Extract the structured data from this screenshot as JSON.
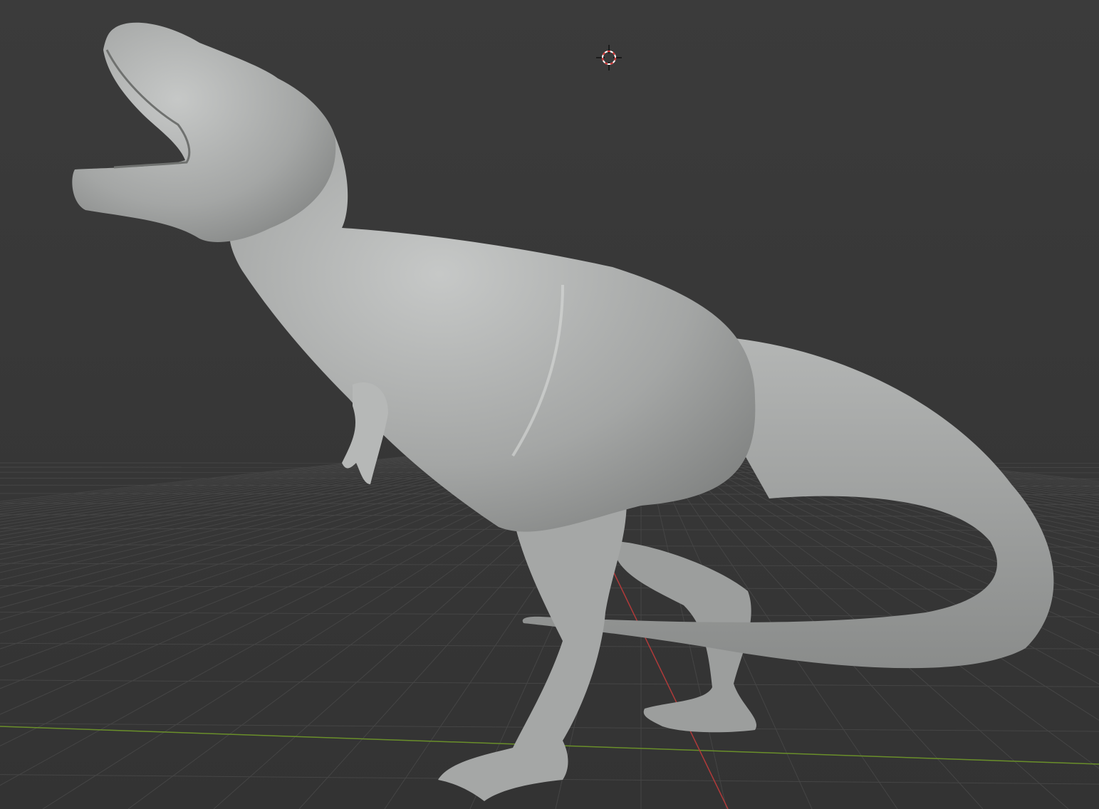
{
  "viewport": {
    "mode": "3D viewport",
    "background_color": "#3a3a3a",
    "grid_color": "#444444",
    "x_axis_color": "#b03a3a",
    "y_axis_color": "#6a8f2a",
    "model_color": "#a9abaa"
  },
  "icons": {
    "cursor": "3d-cursor-icon"
  }
}
